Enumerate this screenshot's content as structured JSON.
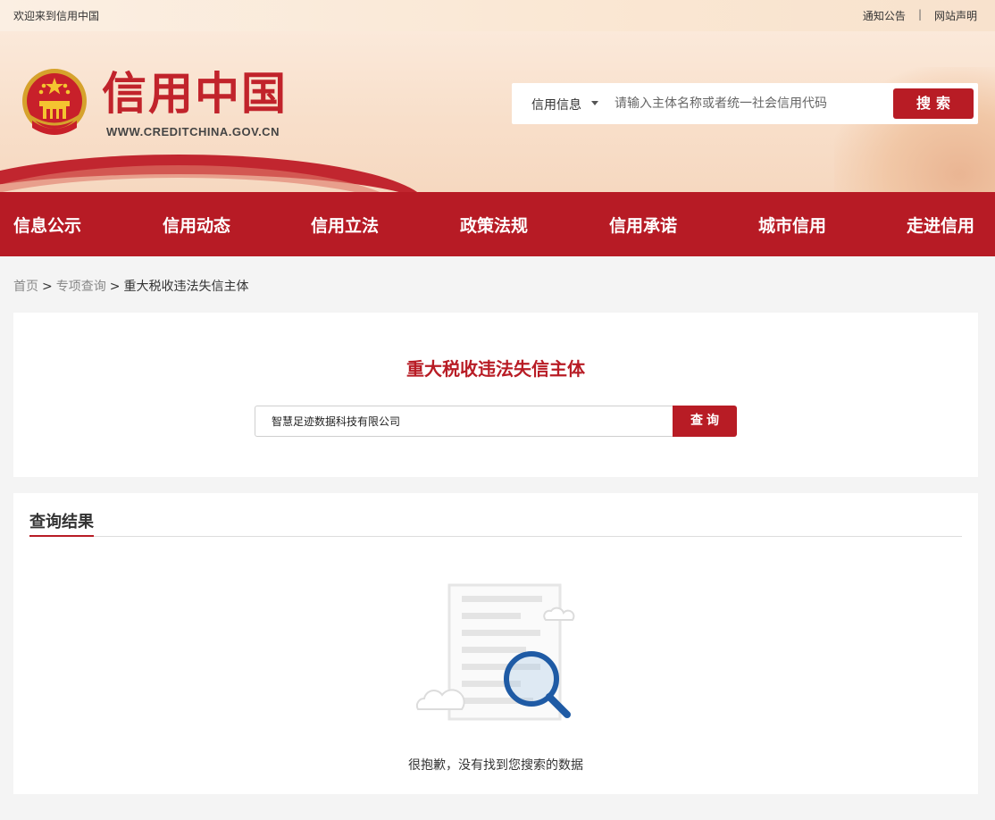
{
  "topbar": {
    "welcome": "欢迎来到信用中国",
    "notice": "通知公告",
    "separator": "|",
    "statement": "网站声明"
  },
  "header": {
    "logo_cn": "信用中国",
    "logo_en": "WWW.CREDITCHINA.GOV.CN",
    "search_scope": "信用信息",
    "search_placeholder": "请输入主体名称或者统一社会信用代码",
    "search_button": "搜索"
  },
  "nav": {
    "items": [
      "信息公示",
      "信用动态",
      "信用立法",
      "政策法规",
      "信用承诺",
      "城市信用",
      "走进信用"
    ]
  },
  "breadcrumb": {
    "home": "首页",
    "sep": ">",
    "section": "专项查询",
    "current": "重大税收违法失信主体"
  },
  "query": {
    "title": "重大税收违法失信主体",
    "input_value": "智慧足迹数据科技有限公司",
    "button": "查询"
  },
  "results": {
    "title": "查询结果",
    "empty_message": "很抱歉，没有找到您搜索的数据"
  },
  "colors": {
    "brand_red": "#b71b25",
    "accent_red": "#c1232b"
  }
}
